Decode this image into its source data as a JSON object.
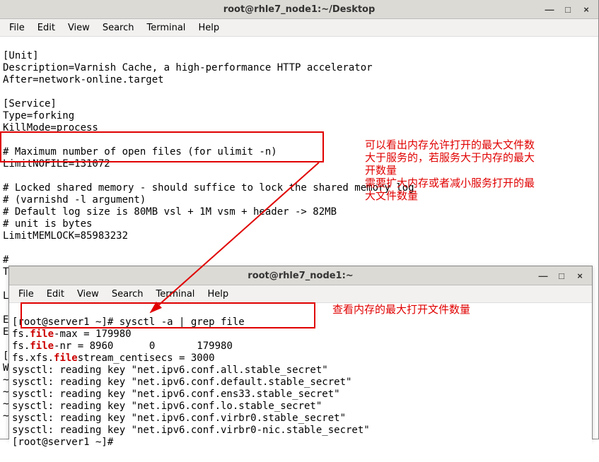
{
  "win1": {
    "title": "root@rhle7_node1:~/Desktop",
    "menu": [
      "File",
      "Edit",
      "View",
      "Search",
      "Terminal",
      "Help"
    ],
    "lines": {
      "l0": "[Unit]",
      "l1": "Description=Varnish Cache, a high-performance HTTP accelerator",
      "l2": "After=network-online.target",
      "l3": "",
      "l4": "[Service]",
      "l5": "Type=forking",
      "l6": "KillMode=process",
      "l7": "",
      "l8": "# Maximum number of open files (for ulimit -n)",
      "l9": "LimitNOFILE=131072",
      "l10": "",
      "l11": "# Locked shared memory - should suffice to lock the shared memory log",
      "l12": "# (varnishd -l argument)",
      "l13": "# Default log size is 80MB vsl + 1M vsm + header -> 82MB",
      "l14": "# unit is bytes",
      "l15": "LimitMEMLOCK=85983232",
      "l16": "",
      "l17": "#",
      "l18": "Ta",
      "l19": "",
      "l20": "Li",
      "l21": "",
      "l22": "Ex",
      "l23": "Ex",
      "l24": "",
      "l25": "[I",
      "l26": "Wa",
      "l27": "~",
      "l28": "~",
      "l29": "~",
      "l30": "~"
    }
  },
  "win2": {
    "title": "root@rhle7_node1:~",
    "menu": [
      "File",
      "Edit",
      "View",
      "Search",
      "Terminal",
      "Help"
    ],
    "lines": {
      "l0a": "[root@server1 ~]# sysctl -a | grep file",
      "l1a": "fs.",
      "l1b": "file",
      "l1c": "-max = 179980",
      "l2a": "fs.",
      "l2b": "file",
      "l2c": "-nr = 8960      0       179980",
      "l3a": "fs.xfs.",
      "l3b": "file",
      "l3c": "stream_centisecs = 3000",
      "l4": "sysctl: reading key \"net.ipv6.conf.all.stable_secret\"",
      "l5": "sysctl: reading key \"net.ipv6.conf.default.stable_secret\"",
      "l6": "sysctl: reading key \"net.ipv6.conf.ens33.stable_secret\"",
      "l7": "sysctl: reading key \"net.ipv6.conf.lo.stable_secret\"",
      "l8": "sysctl: reading key \"net.ipv6.conf.virbr0.stable_secret\"",
      "l9": "sysctl: reading key \"net.ipv6.conf.virbr0-nic.stable_secret\"",
      "l10": "[root@server1 ~]#"
    }
  },
  "annotations": {
    "a1": "可以看出内存允许打开的最大文件数\n大于服务的，若服务大于内存的最大\n开数量\n需要扩大内存或者减小服务打开的最\n大文件数量",
    "a2": "查看内存的最大打开文件数量"
  },
  "buttons": {
    "min": "—",
    "max": "□",
    "close": "×"
  }
}
